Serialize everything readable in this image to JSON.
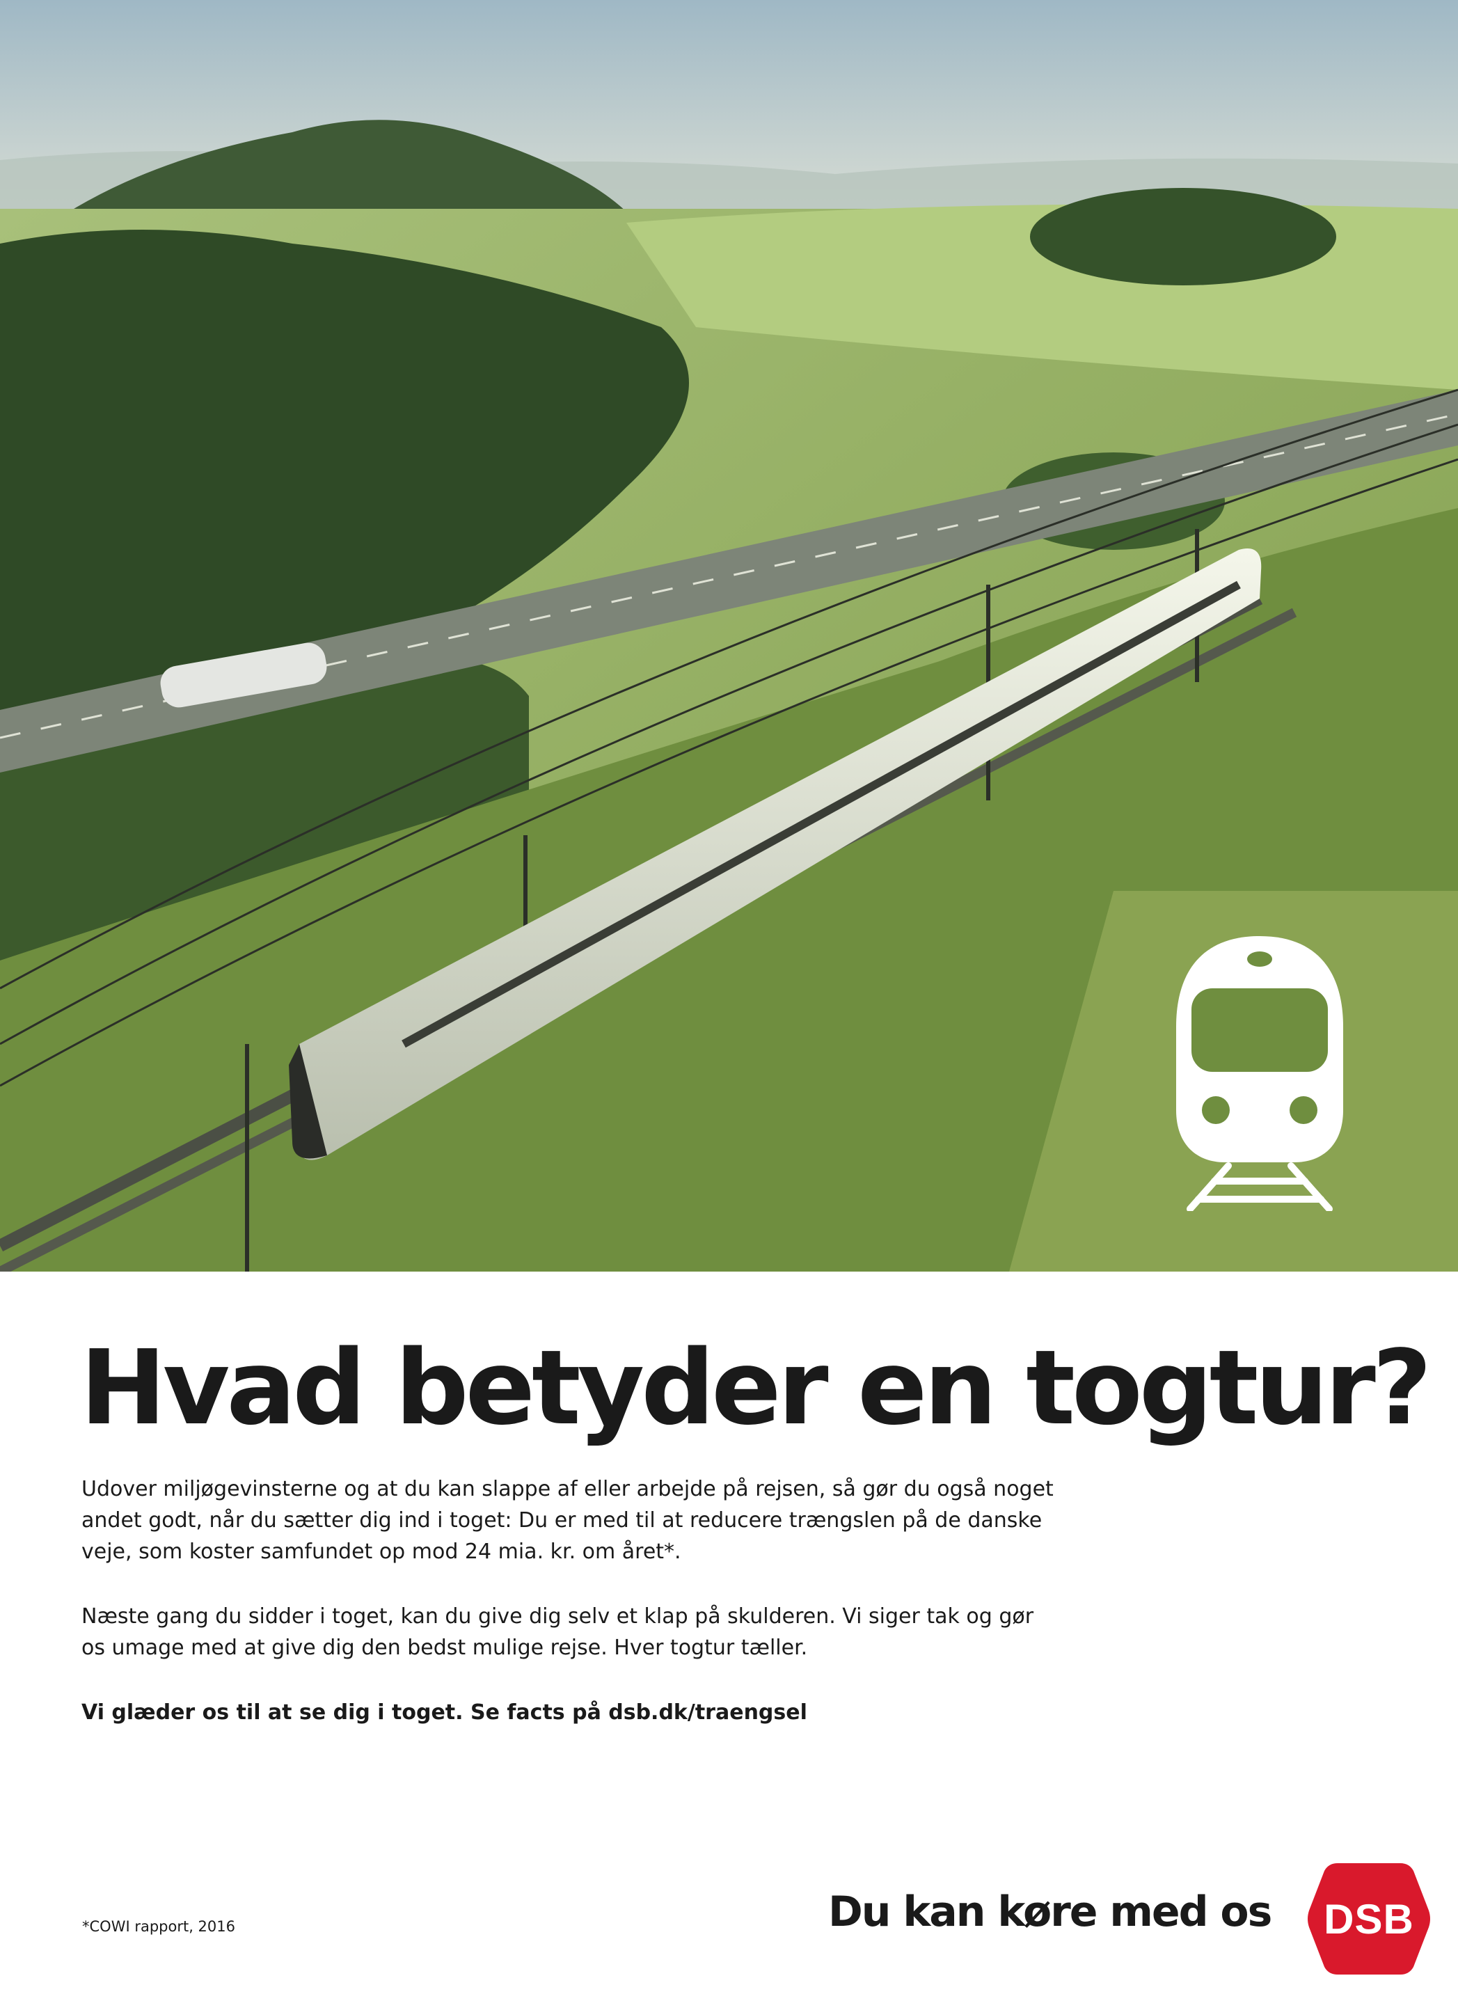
{
  "hero": {
    "photo": "aerial-train-landscape",
    "icon": "train-front-icon",
    "icon_color": "#ffffff"
  },
  "headline": "Hvad betyder en togtur?",
  "body": {
    "paragraph_1": "Udover miljøgevinsterne og at du kan slappe af eller arbejde på rejsen, så gør du også noget andet godt, når du sætter dig ind i toget: Du er med til at reducere trængslen på de danske veje, som koster samfundet op mod 24 mia. kr. om året*.",
    "paragraph_2": "Næste gang du sidder i toget, kan du give dig selv et klap på skulderen. Vi siger tak og gør os umage med at give dig den bedst mulige rejse. Hver togtur tæller.",
    "cta": "Vi glæder os til at se dig i toget. Se facts på dsb.dk/traengsel"
  },
  "footnote": "*COWI rapport, 2016",
  "slogan": "Du kan køre med os",
  "logo": {
    "text": "DSB",
    "color": "#d9192c"
  }
}
